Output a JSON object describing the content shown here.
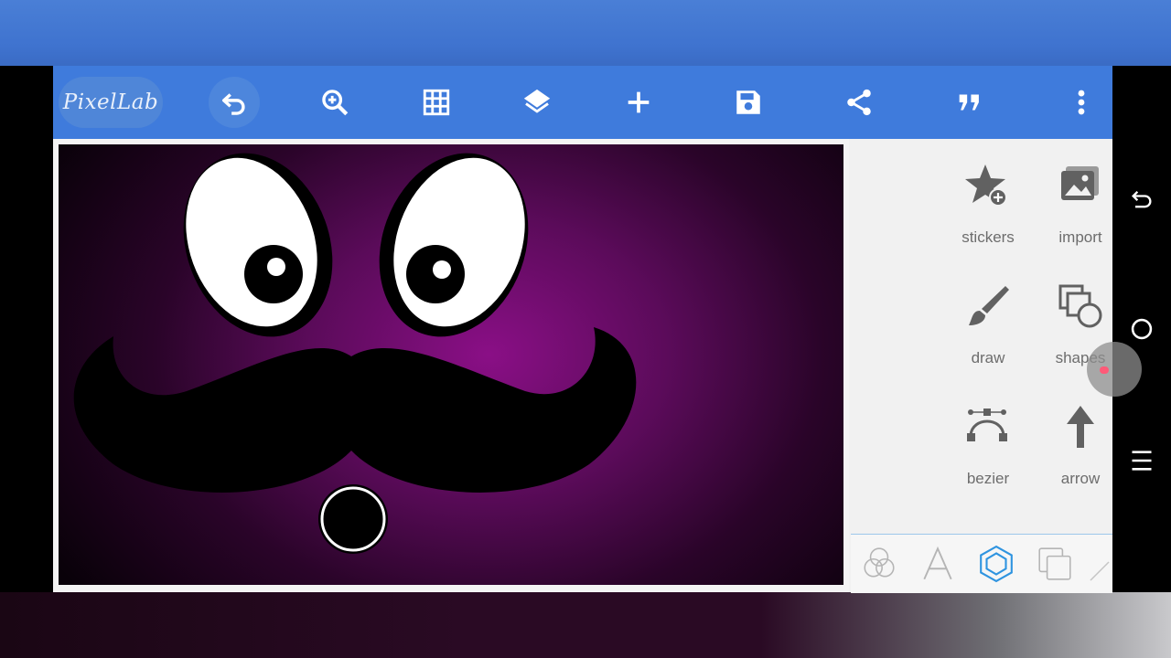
{
  "app": {
    "logo_text": "PixelLab"
  },
  "toolbar": {
    "buttons": [
      {
        "name": "undo",
        "icon": "undo-icon",
        "active": true
      },
      {
        "name": "zoom",
        "icon": "zoom-in-icon"
      },
      {
        "name": "grid",
        "icon": "grid-icon"
      },
      {
        "name": "layers",
        "icon": "layers-icon"
      },
      {
        "name": "add",
        "icon": "plus-icon"
      },
      {
        "name": "save",
        "icon": "save-icon"
      },
      {
        "name": "share",
        "icon": "share-icon"
      },
      {
        "name": "quote",
        "icon": "quote-icon"
      },
      {
        "name": "more",
        "icon": "more-vertical-icon"
      }
    ]
  },
  "panel": {
    "tools": [
      {
        "label": "stickers",
        "icon": "sticker-star-plus-icon"
      },
      {
        "label": "import",
        "icon": "image-import-icon"
      },
      {
        "label": "draw",
        "icon": "paint-brush-icon"
      },
      {
        "label": "shapes",
        "icon": "shapes-icon"
      },
      {
        "label": "bezier",
        "icon": "bezier-curve-icon"
      },
      {
        "label": "arrow",
        "icon": "arrow-up-icon"
      }
    ],
    "tabs": [
      {
        "icon": "blend-circles-icon"
      },
      {
        "icon": "text-a-icon"
      },
      {
        "icon": "hexagon-icon",
        "active": true
      },
      {
        "icon": "layer-squares-icon"
      },
      {
        "icon": "line-icon"
      }
    ]
  },
  "canvas": {
    "background_colors": [
      "#8a0f86",
      "#090109"
    ],
    "artwork": "face-eyes-mustache"
  },
  "system_nav": {
    "buttons": [
      {
        "icon": "back-icon"
      },
      {
        "icon": "home-circle-icon"
      },
      {
        "icon": "menu-icon"
      }
    ]
  },
  "colors": {
    "toolbar": "#3f7bdc",
    "accent": "#3a8fd8",
    "panel": "#f1f1f1"
  }
}
